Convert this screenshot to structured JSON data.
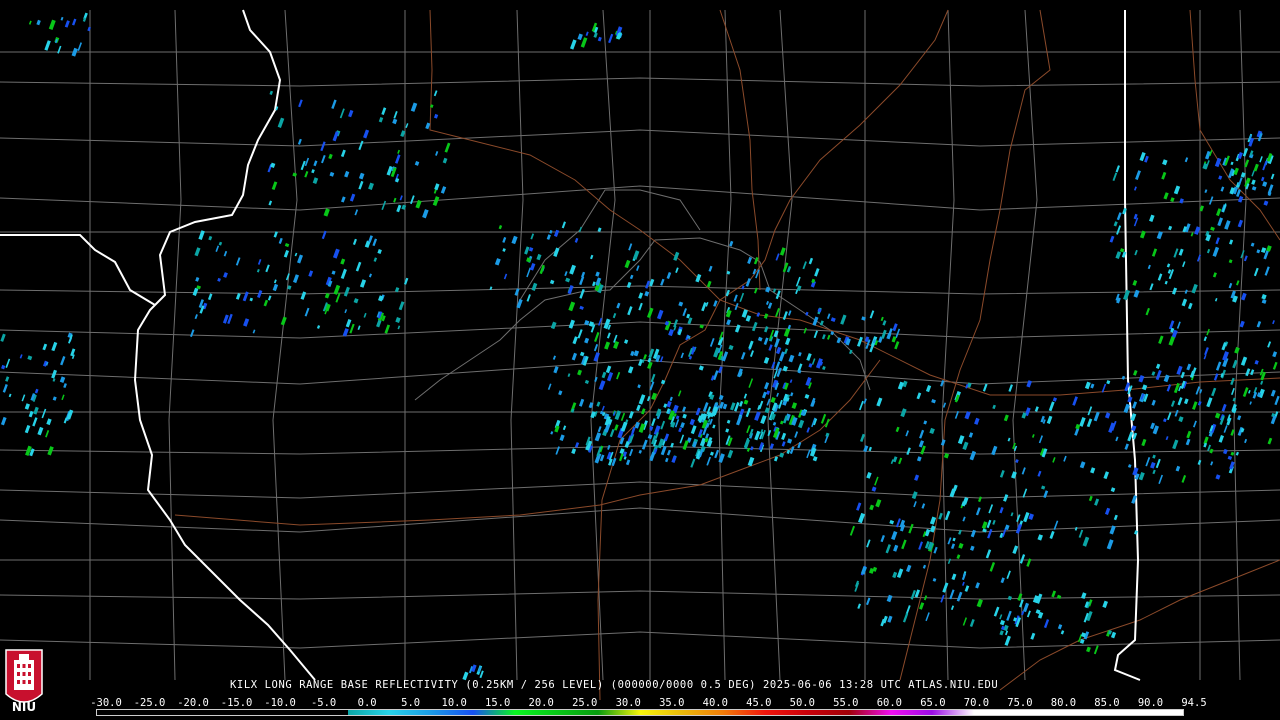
{
  "caption": "KILX LONG RANGE BASE REFLECTIVITY (0.25KM / 256 LEVEL) (000000/0000 0.5 DEG) 2025-06-06 13:28 UTC  ATLAS.NIU.EDU",
  "logo": {
    "text": "NIU",
    "icon": "university-tower-icon"
  },
  "scale": {
    "labels": [
      "-30.0",
      "-25.0",
      "-20.0",
      "-15.0",
      "-10.0",
      "-5.0",
      "0.0",
      "5.0",
      "10.0",
      "15.0",
      "20.0",
      "25.0",
      "30.0",
      "35.0",
      "40.0",
      "45.0",
      "50.0",
      "55.0",
      "60.0",
      "65.0",
      "70.0",
      "75.0",
      "80.0",
      "85.0",
      "90.0",
      "94.5"
    ],
    "colors": [
      "#000000",
      "#000000",
      "#000000",
      "#000000",
      "#000000",
      "#000000",
      "#0ba5a5",
      "#27d3e8",
      "#1b9be6",
      "#1750f0",
      "#09f521",
      "#08c718",
      "#089b10",
      "#f6f60c",
      "#e8b90a",
      "#f07c09",
      "#f0160d",
      "#c9000a",
      "#a00008",
      "#f00ef0",
      "#9b0de7",
      "#ffffff",
      "#ffffff",
      "#ffffff",
      "#ffffff",
      "#ffffff"
    ]
  },
  "colors": {
    "background": "#000000",
    "county_lines": "#7a7a7a",
    "state_lines": "#ffffff",
    "highways": "#8b4a2a"
  }
}
